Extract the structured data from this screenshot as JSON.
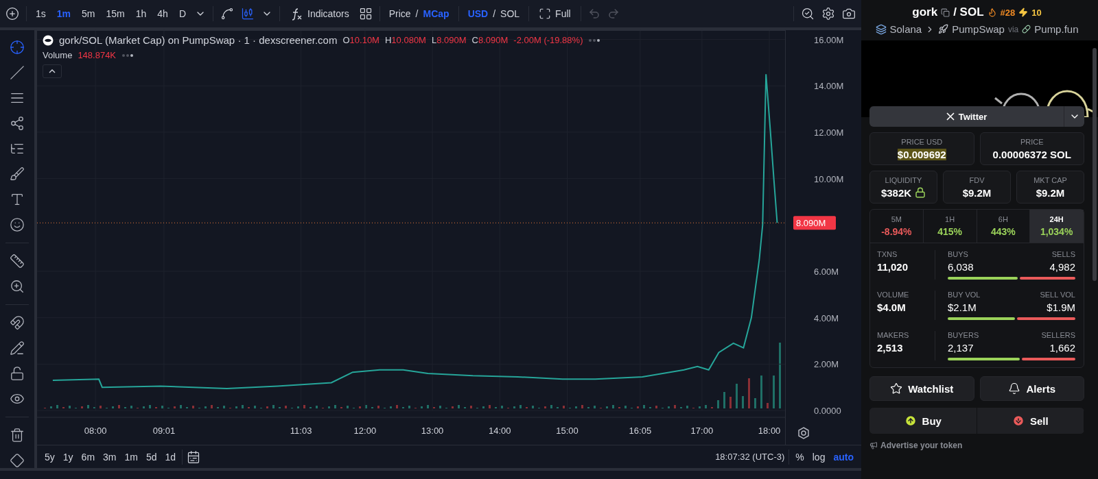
{
  "toolbar": {
    "intervals": [
      {
        "label": "1s",
        "selected": false
      },
      {
        "label": "1m",
        "selected": true
      },
      {
        "label": "5m",
        "selected": false
      },
      {
        "label": "15m",
        "selected": false
      },
      {
        "label": "1h",
        "selected": false
      },
      {
        "label": "4h",
        "selected": false
      },
      {
        "label": "D",
        "selected": false
      }
    ],
    "indicators": "Indicators",
    "value_mode": {
      "separator": "/",
      "options": [
        {
          "label": "Price",
          "selected": false
        },
        {
          "label": "MCap",
          "selected": true
        }
      ]
    },
    "currency": {
      "separator": "/",
      "options": [
        {
          "label": "USD",
          "selected": true
        },
        {
          "label": "SOL",
          "selected": false
        }
      ]
    },
    "fullscreen": "Full"
  },
  "chart": {
    "title": "gork/SOL (Market Cap) on PumpSwap · 1 · dexscreener.com",
    "ohlc": [
      {
        "key": "O",
        "value": "10.10M"
      },
      {
        "key": "H",
        "value": "10.080M"
      },
      {
        "key": "L",
        "value": "8.090M"
      },
      {
        "key": "C",
        "value": "8.090M"
      }
    ],
    "change": "-2.00M (-19.88%)",
    "volume_label": "Volume",
    "volume_value": "148.874K",
    "last_price_label": "8.090M",
    "chart_data": {
      "type": "line",
      "xlim": [
        428,
        1094
      ],
      "ylim": [
        0,
        16.4
      ],
      "grid": true,
      "ref_lines": [
        {
          "axis": "y",
          "value": 8.09,
          "color": "#f07a3a"
        }
      ],
      "xticks": [
        {
          "value": 480,
          "label": "08:00"
        },
        {
          "value": 541,
          "label": "09:01"
        },
        {
          "value": 663,
          "label": "11:03"
        },
        {
          "value": 720,
          "label": "12:00"
        },
        {
          "value": 780,
          "label": "13:00"
        },
        {
          "value": 840,
          "label": "14:00"
        },
        {
          "value": 900,
          "label": "15:00"
        },
        {
          "value": 965,
          "label": "16:05"
        },
        {
          "value": 1020,
          "label": "17:00"
        },
        {
          "value": 1080,
          "label": "18:00"
        }
      ],
      "yticks": [
        {
          "value": 0,
          "label": "0.0000"
        },
        {
          "value": 2,
          "label": "2.00M"
        },
        {
          "value": 4,
          "label": "4.00M"
        },
        {
          "value": 6,
          "label": "6.00M"
        },
        {
          "value": 10,
          "label": "10.00M"
        },
        {
          "value": 12,
          "label": "12.00M"
        },
        {
          "value": 14,
          "label": "14.00M"
        },
        {
          "value": 16,
          "label": "16.00M"
        }
      ],
      "x": [
        442,
        483,
        486,
        538,
        597,
        642,
        690,
        709,
        733,
        754,
        776,
        816,
        856,
        896,
        925,
        967,
        1004,
        1016,
        1026,
        1035,
        1048,
        1057,
        1064,
        1071,
        1074,
        1077,
        1081,
        1084,
        1087
      ],
      "series": [
        {
          "color": "#26a69a",
          "values": [
            1.3,
            1.35,
            1.0,
            1.05,
            0.95,
            1.05,
            1.2,
            1.65,
            1.75,
            1.75,
            1.6,
            1.5,
            1.45,
            1.35,
            1.35,
            1.45,
            1.75,
            1.9,
            1.75,
            2.5,
            2.9,
            2.7,
            4.0,
            6.5,
            8.0,
            14.5,
            12.0,
            10.0,
            8.09
          ]
        }
      ]
    }
  },
  "bottom_bar": {
    "ranges": [
      "5y",
      "1y",
      "6m",
      "3m",
      "1m",
      "5d",
      "1d"
    ],
    "time": "18:07:32 (UTC-3)",
    "scale_options": [
      {
        "label": "%",
        "selected": false
      },
      {
        "label": "log",
        "selected": false
      },
      {
        "label": "auto",
        "selected": true
      }
    ]
  },
  "token": {
    "name": "gork",
    "quote": "/ SOL",
    "rank": "#28",
    "boosts": "10",
    "breadcrumb": {
      "chain": "Solana",
      "dex": "PumpSwap",
      "via": "via",
      "launchpad": "Pump.fun"
    },
    "social_button": "Twitter",
    "prices": [
      {
        "label": "PRICE USD",
        "value": "$0.009692",
        "highlighted": true
      },
      {
        "label": "PRICE",
        "value": "0.00006372 SOL",
        "highlighted": false
      }
    ],
    "metrics": [
      {
        "label": "LIQUIDITY",
        "value": "$382K",
        "locked": true
      },
      {
        "label": "FDV",
        "value": "$9.2M",
        "locked": false
      },
      {
        "label": "MKT CAP",
        "value": "$9.2M",
        "locked": false
      }
    ],
    "periods": [
      {
        "label": "5M",
        "change": "-8.94%",
        "color": "#ea5a5a",
        "selected": false
      },
      {
        "label": "1H",
        "change": "415%",
        "color": "#9bd35a",
        "selected": false
      },
      {
        "label": "6H",
        "change": "443%",
        "color": "#9bd35a",
        "selected": false
      },
      {
        "label": "24H",
        "change": "1,034%",
        "color": "#9bd35a",
        "selected": true
      }
    ],
    "stats": [
      {
        "label": "TXNS",
        "value": "11,020",
        "buy_label": "BUYS",
        "buy_value": "6,038",
        "sell_label": "SELLS",
        "sell_value": "4,982",
        "level": 0.548
      },
      {
        "label": "VOLUME",
        "value": "$4.0M",
        "buy_label": "BUY VOL",
        "buy_value": "$2.1M",
        "sell_label": "SELL VOL",
        "sell_value": "$1.9M",
        "level": 0.525
      },
      {
        "label": "MAKERS",
        "value": "2,513",
        "buy_label": "BUYERS",
        "buy_value": "2,137",
        "sell_label": "SELLERS",
        "sell_value": "1,662",
        "level": 0.563
      }
    ],
    "watchlist": "Watchlist",
    "alerts": "Alerts",
    "buy": "Buy",
    "sell": "Sell",
    "advertise": "Advertise your token"
  }
}
